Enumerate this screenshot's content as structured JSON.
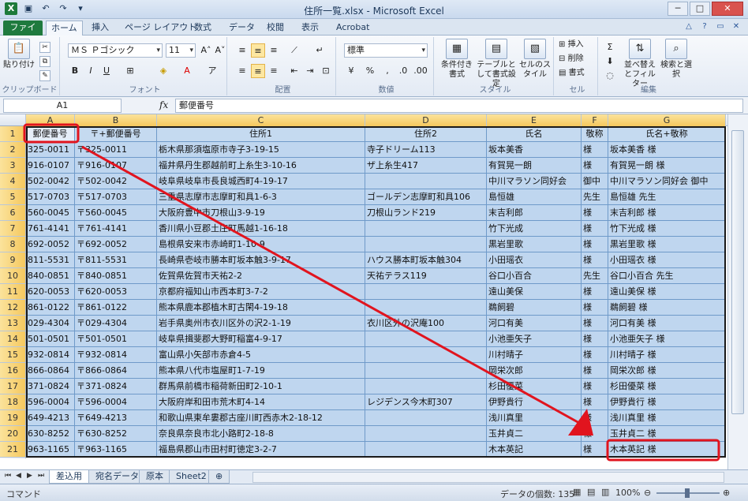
{
  "window": {
    "title": "住所一覧.xlsx - Microsoft Excel"
  },
  "ribbon_tabs": [
    "ファイル",
    "ホーム",
    "挿入",
    "ページ レイアウト",
    "数式",
    "データ",
    "校閲",
    "表示",
    "Acrobat"
  ],
  "ribbon": {
    "paste_label": "貼り付け",
    "font_name": "ＭＳ Ｐゴシック",
    "font_size": "11",
    "number_format": "標準",
    "conditional_label": "条件付き書式",
    "table_label": "テーブルとして書式設定",
    "cellstyle_label": "セルのスタイル",
    "insert_label": "挿入",
    "delete_label": "削除",
    "format_label": "書式",
    "sort_label": "並べ替えとフィルター",
    "find_label": "検索と選択",
    "groups": {
      "clipboard": "クリップボード",
      "font": "フォント",
      "alignment": "配置",
      "number": "数値",
      "styles": "スタイル",
      "cells": "セル",
      "editing": "編集"
    }
  },
  "formula_bar": {
    "name_box": "A1",
    "fx": "fx",
    "content": "郵便番号"
  },
  "columns": [
    "A",
    "B",
    "C",
    "D",
    "E",
    "F",
    "G"
  ],
  "rows": [
    [
      "郵便番号",
      "〒+郵便番号",
      "住所1",
      "住所2",
      "氏名",
      "敬称",
      "氏名+敬称"
    ],
    [
      "325-0011",
      "〒325-0011",
      "栃木県那須塩原市寺子3-19-15",
      "寺子ドリーム113",
      "坂本美香",
      "様",
      "坂本美香 様"
    ],
    [
      "916-0107",
      "〒916-0107",
      "福井県丹生郡越前町上糸生3-10-16",
      "ザ上糸生417",
      "有賀晃一朗",
      "様",
      "有賀晃一朗 様"
    ],
    [
      "502-0042",
      "〒502-0042",
      "岐阜県岐阜市長良城西町4-19-17",
      "",
      "中川マラソン同好会",
      "御中",
      "中川マラソン同好会 御中"
    ],
    [
      "517-0703",
      "〒517-0703",
      "三重県志摩市志摩町和具1-6-3",
      "ゴールデン志摩町和具106",
      "島恒雄",
      "先生",
      "島恒雄 先生"
    ],
    [
      "560-0045",
      "〒560-0045",
      "大阪府豊中市刀根山3-9-19",
      "刀根山ランド219",
      "末吉利郎",
      "様",
      "末吉利郎 様"
    ],
    [
      "761-4141",
      "〒761-4141",
      "香川県小豆郡土庄町馬越1-16-18",
      "",
      "竹下光成",
      "様",
      "竹下光成 様"
    ],
    [
      "692-0052",
      "〒692-0052",
      "島根県安来市赤崎町1-10-9",
      "",
      "黒岩里歌",
      "様",
      "黒岩里歌 様"
    ],
    [
      "811-5531",
      "〒811-5531",
      "長崎県壱岐市勝本町坂本触3-9-17",
      "ハウス勝本町坂本触304",
      "小田瑶衣",
      "様",
      "小田瑶衣 様"
    ],
    [
      "840-0851",
      "〒840-0851",
      "佐賀県佐賀市天祐2-2",
      "天祐テラス119",
      "谷口小百合",
      "先生",
      "谷口小百合 先生"
    ],
    [
      "620-0053",
      "〒620-0053",
      "京都府福知山市西本町3-7-2",
      "",
      "遠山美保",
      "様",
      "遠山美保 様"
    ],
    [
      "861-0122",
      "〒861-0122",
      "熊本県鹿本郡植木町古閑4-19-18",
      "",
      "鵜飼碧",
      "様",
      "鵜飼碧 様"
    ],
    [
      "029-4304",
      "〒029-4304",
      "岩手県奥州市衣川区外の沢2-1-19",
      "衣川区外の沢庵100",
      "河口有美",
      "様",
      "河口有美 様"
    ],
    [
      "501-0501",
      "〒501-0501",
      "岐阜県揖斐郡大野町稲富4-9-17",
      "",
      "小池亜矢子",
      "様",
      "小池亜矢子 様"
    ],
    [
      "932-0814",
      "〒932-0814",
      "富山県小矢部市赤倉4-5",
      "",
      "川村晴子",
      "様",
      "川村晴子 様"
    ],
    [
      "866-0864",
      "〒866-0864",
      "熊本県八代市塩屋町1-7-19",
      "",
      "岡栄次郎",
      "様",
      "岡栄次郎 様"
    ],
    [
      "371-0824",
      "〒371-0824",
      "群馬県前橋市稲荷新田町2-10-1",
      "",
      "杉田優菜",
      "様",
      "杉田優菜 様"
    ],
    [
      "596-0004",
      "〒596-0004",
      "大阪府岸和田市荒木町4-14",
      "レジデンス今木町307",
      "伊野貴行",
      "様",
      "伊野貴行 様"
    ],
    [
      "649-4213",
      "〒649-4213",
      "和歌山県東牟婁郡古座川町西赤木2-18-12",
      "",
      "浅川真里",
      "様",
      "浅川真里 様"
    ],
    [
      "630-8252",
      "〒630-8252",
      "奈良県奈良市北小路町2-18-8",
      "",
      "玉井貞二",
      "様",
      "玉井貞二 様"
    ],
    [
      "963-1165",
      "〒963-1165",
      "福島県郡山市田村町徳定3-2-7",
      "",
      "木本英記",
      "様",
      "木本英記 様"
    ]
  ],
  "sheet_tabs": [
    "差込用",
    "宛名データ",
    "原本",
    "Sheet2"
  ],
  "status": {
    "mode": "コマンド",
    "count": "データの個数: 135",
    "zoom": "100%"
  },
  "colors": {
    "selection_fill": "#bfd6ef",
    "annotation_red": "#e1141e",
    "file_tab": "#1f7a3e"
  }
}
